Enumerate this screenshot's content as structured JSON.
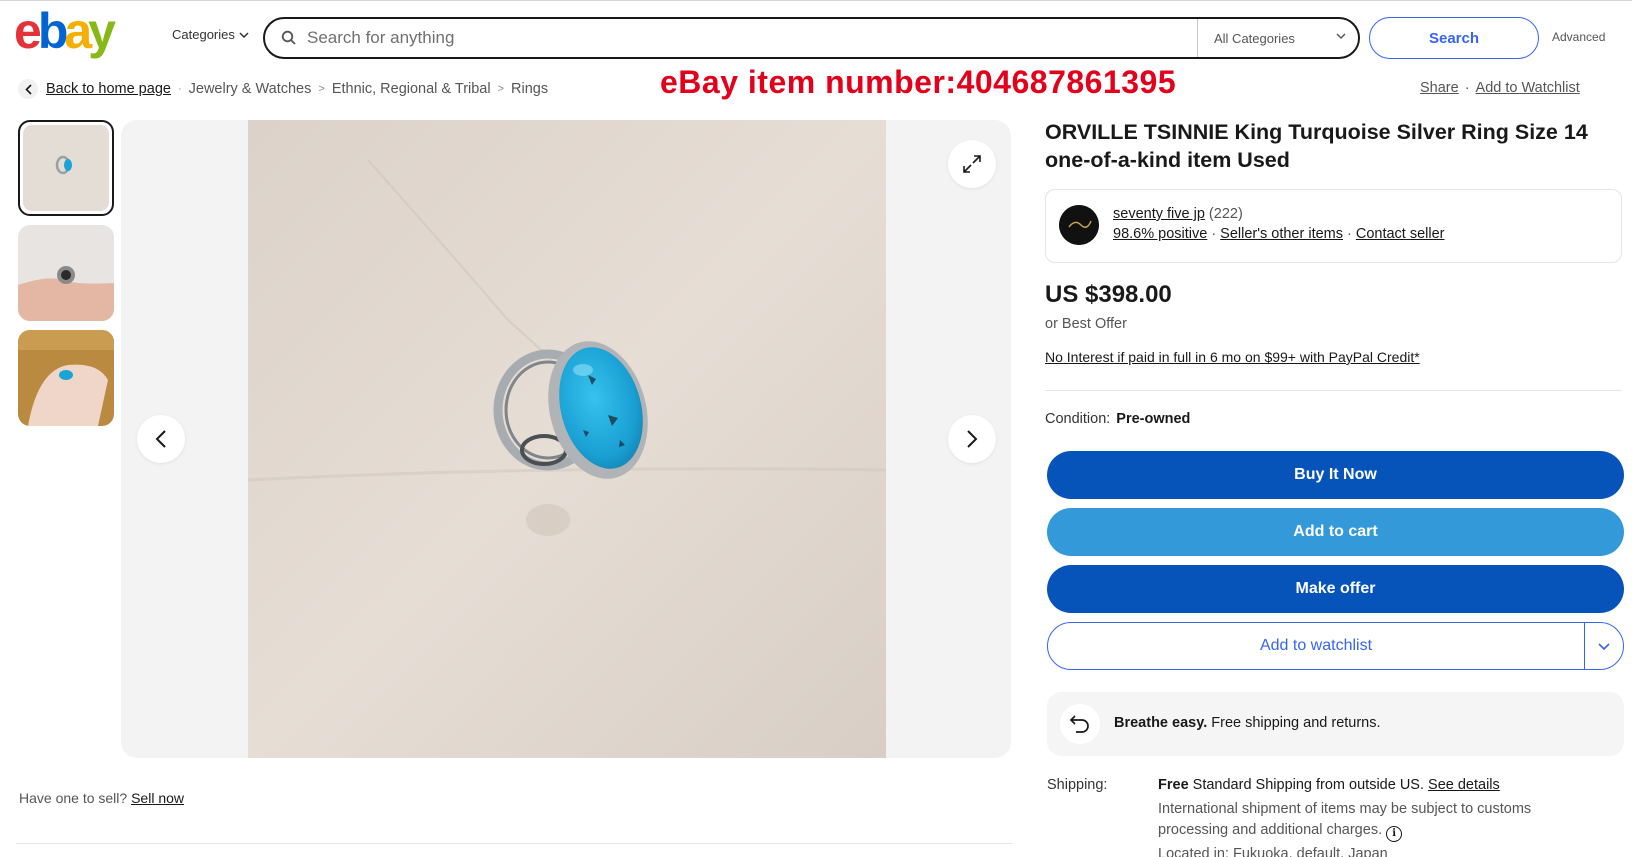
{
  "header": {
    "logo_letters": [
      "e",
      "b",
      "a",
      "y"
    ],
    "logo_colors": [
      "#e53238",
      "#0064d2",
      "#f5af02",
      "#86b817"
    ],
    "categories_label": "Categories",
    "search_placeholder": "Search for anything",
    "all_categories_label": "All Categories",
    "search_button_label": "Search",
    "advanced_label": "Advanced"
  },
  "breadcrumb": {
    "back_label": "Back to home page",
    "crumbs": [
      "Jewelry & Watches",
      "Ethnic, Regional & Tribal",
      "Rings"
    ]
  },
  "banner": {
    "text": "eBay item number:404687861395"
  },
  "top_actions": {
    "share_label": "Share",
    "watchlist_label": "Add to Watchlist"
  },
  "listing": {
    "title": "ORVILLE TSINNIE King Turquoise Silver Ring Size 14 one-of-a-kind item Used",
    "seller": {
      "name": "seventy five jp",
      "feedback_count": "(222)",
      "positive": "98.6% positive",
      "other_items": "Seller's other items",
      "contact": "Contact seller"
    },
    "price": "US $398.00",
    "best_offer": "or Best Offer",
    "paypal_text": "No Interest if paid in full in 6 mo on $99+ with PayPal Credit*",
    "condition_label": "Condition:",
    "condition_value": "Pre-owned",
    "buttons": {
      "buy_now": "Buy It Now",
      "add_to_cart": "Add to cart",
      "make_offer": "Make offer",
      "add_to_watchlist": "Add to watchlist"
    },
    "breathe": {
      "bold": "Breathe easy.",
      "rest": " Free shipping and returns."
    },
    "shipping": {
      "label": "Shipping:",
      "free": "Free",
      "main": " Standard Shipping from outside US. ",
      "see_details": "See details",
      "note": "International shipment of items may be subject to customs processing and additional charges.",
      "located": "Located in: Fukuoka, default, Japan"
    }
  },
  "sell": {
    "prefix": "Have one to sell? ",
    "link": "Sell now"
  },
  "colors": {
    "primary_blue": "#0654ba",
    "cart_blue": "#3399d8",
    "link_blue": "#3665f3",
    "banner_red": "#e3001b",
    "turquoise": "#1aa3d6"
  }
}
